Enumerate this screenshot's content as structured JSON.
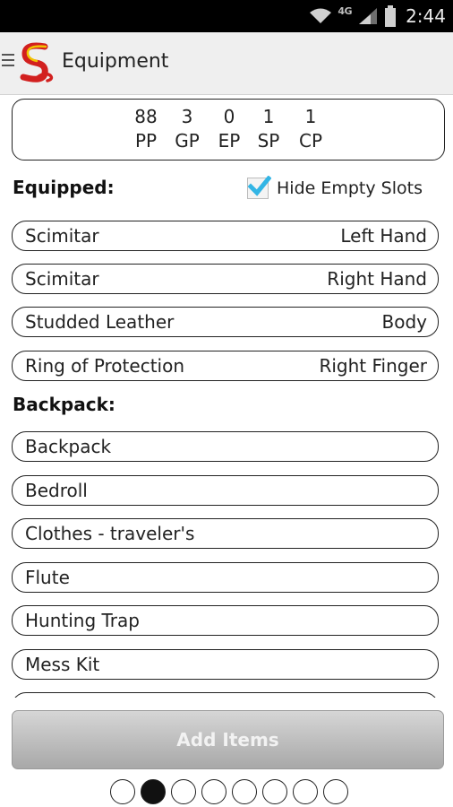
{
  "status_bar": {
    "network": "4G",
    "time": "2:44"
  },
  "action_bar": {
    "title": "Equipment",
    "icons": [
      "menu-icon",
      "app-logo-icon"
    ]
  },
  "currency": [
    {
      "value": "88",
      "label": "PP"
    },
    {
      "value": "3",
      "label": "GP"
    },
    {
      "value": "0",
      "label": "EP"
    },
    {
      "value": "1",
      "label": "SP"
    },
    {
      "value": "1",
      "label": "CP"
    }
  ],
  "equipped": {
    "heading": "Equipped:",
    "hide_empty_label": "Hide Empty Slots",
    "hide_empty_checked": true,
    "items": [
      {
        "name": "Scimitar",
        "slot": "Left Hand"
      },
      {
        "name": "Scimitar",
        "slot": "Right Hand"
      },
      {
        "name": "Studded Leather",
        "slot": "Body"
      },
      {
        "name": "Ring of Protection",
        "slot": "Right Finger"
      }
    ]
  },
  "backpack": {
    "heading": "Backpack:",
    "items": [
      {
        "name": "Backpack"
      },
      {
        "name": "Bedroll"
      },
      {
        "name": "Clothes - traveler's"
      },
      {
        "name": "Flute"
      },
      {
        "name": "Hunting Trap"
      },
      {
        "name": "Mess Kit"
      }
    ]
  },
  "add_button_label": "Add Items",
  "pager": {
    "page_count": 8,
    "active_index": 1
  },
  "colors": {
    "checkbox_accent": "#33b5e5",
    "logo_red": "#d2201f",
    "logo_yellow": "#f2c300"
  }
}
